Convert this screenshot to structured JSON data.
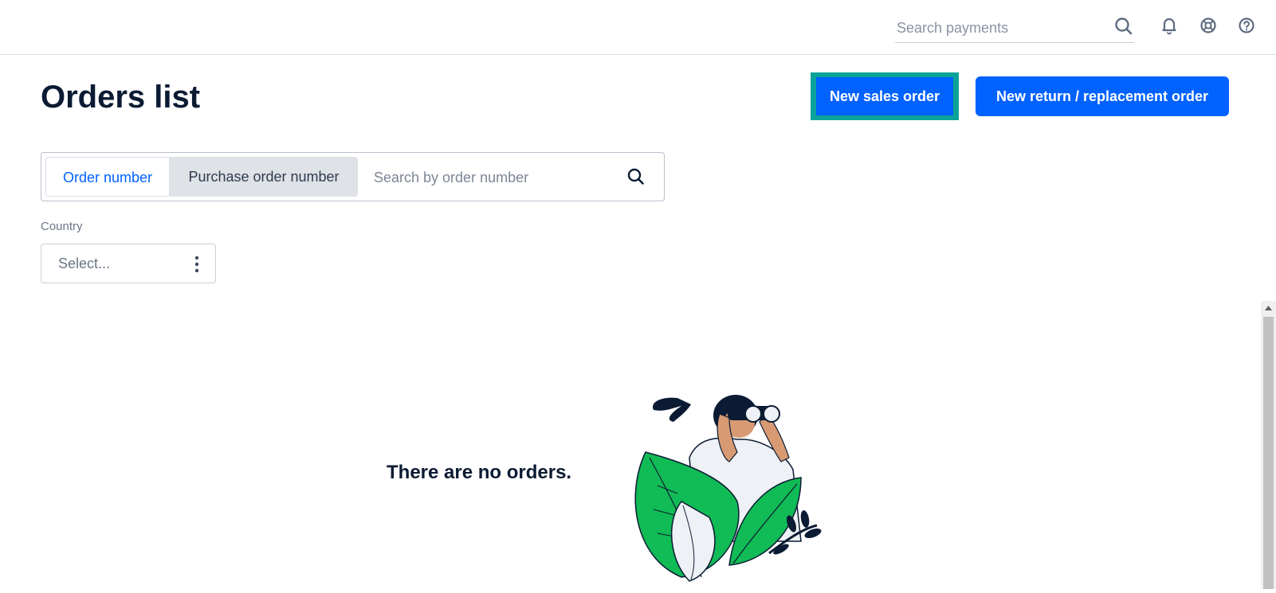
{
  "header": {
    "search_placeholder": "Search payments",
    "icons": [
      "search-icon",
      "bell-icon",
      "lifebuoy-icon",
      "help-icon"
    ]
  },
  "page": {
    "title": "Orders list",
    "new_sales_order_label": "New sales order",
    "new_return_label": "New return / replacement order"
  },
  "filter": {
    "tabs": [
      "Order number",
      "Purchase order number"
    ],
    "selected_tab": "Purchase order number",
    "search_placeholder": "Search by order number"
  },
  "country": {
    "label": "Country",
    "placeholder": "Select..."
  },
  "empty_state": {
    "message": "There are no orders."
  },
  "colors": {
    "primary": "#0062ff",
    "focus_outline": "#0aa39a",
    "leaf_green": "#11bb55",
    "dark_navy": "#0b1b33"
  }
}
